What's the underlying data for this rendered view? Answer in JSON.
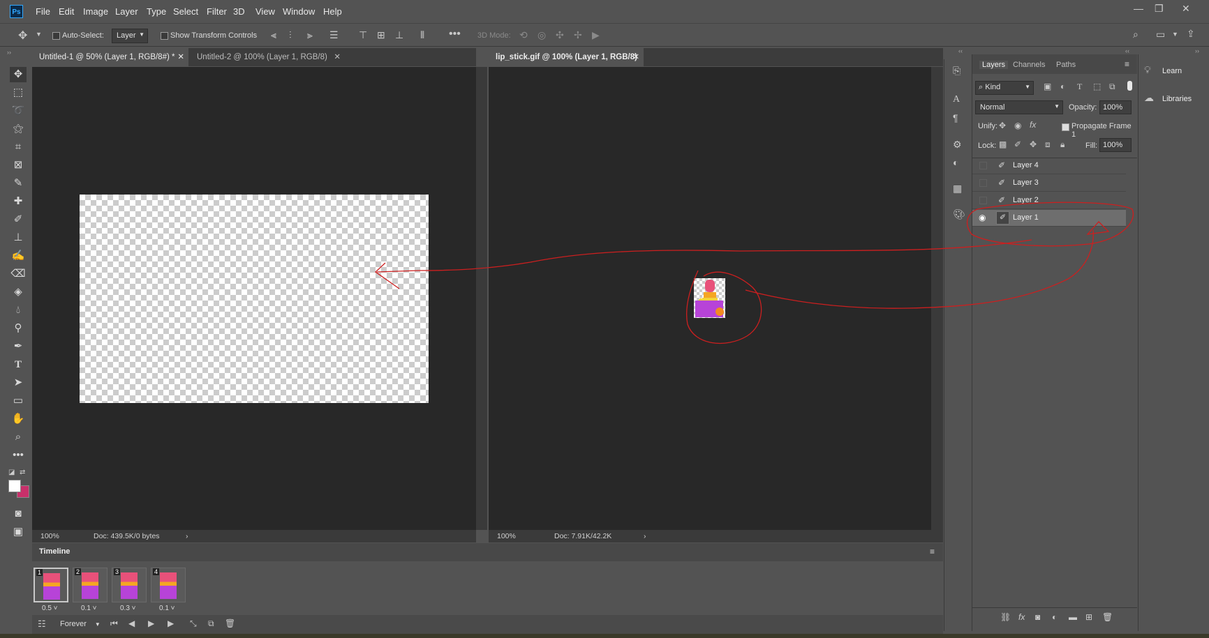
{
  "app": {
    "logo": "Ps"
  },
  "menu": [
    "File",
    "Edit",
    "Image",
    "Layer",
    "Type",
    "Select",
    "Filter",
    "3D",
    "View",
    "Window",
    "Help"
  ],
  "window_controls": {
    "minimize": "—",
    "restore": "❐",
    "close": "✕"
  },
  "options": {
    "auto_select_label": "Auto-Select:",
    "auto_select_value": "Layer",
    "transform_label": "Show Transform Controls",
    "mode_3d_label": "3D Mode:"
  },
  "docs": [
    {
      "tab": "Untitled-1 @ 50% (Layer 1, RGB/8#) *",
      "zoom": "100%",
      "doc": "Doc: 439.5K/0 bytes"
    },
    {
      "tab": "Untitled-2 @ 100% (Layer 1, RGB/8)"
    },
    {
      "tab": "lip_stick.gif @ 100% (Layer 1, RGB/8)",
      "zoom": "100%",
      "doc": "Doc: 7.91K/42.2K"
    }
  ],
  "timeline": {
    "title": "Timeline",
    "loop": "Forever",
    "frames": [
      {
        "num": "1",
        "delay": "0.5"
      },
      {
        "num": "2",
        "delay": "0.1"
      },
      {
        "num": "3",
        "delay": "0.3"
      },
      {
        "num": "4",
        "delay": "0.1"
      }
    ]
  },
  "layers_panel": {
    "tabs": [
      "Layers",
      "Channels",
      "Paths"
    ],
    "kind": "Kind",
    "blend": "Normal",
    "opacity_label": "Opacity:",
    "opacity": "100%",
    "unify_label": "Unify:",
    "propagate": "Propagate Frame 1",
    "lock_label": "Lock:",
    "fill_label": "Fill:",
    "fill": "100%",
    "layers": [
      "Layer 4",
      "Layer 3",
      "Layer 2",
      "Layer 1"
    ]
  },
  "right_panel": {
    "learn": "Learn",
    "libraries": "Libraries"
  },
  "colors": {
    "annotation": "#cc1f1f",
    "accent": "#31a8ff",
    "background_swatch": "#c8306a"
  }
}
